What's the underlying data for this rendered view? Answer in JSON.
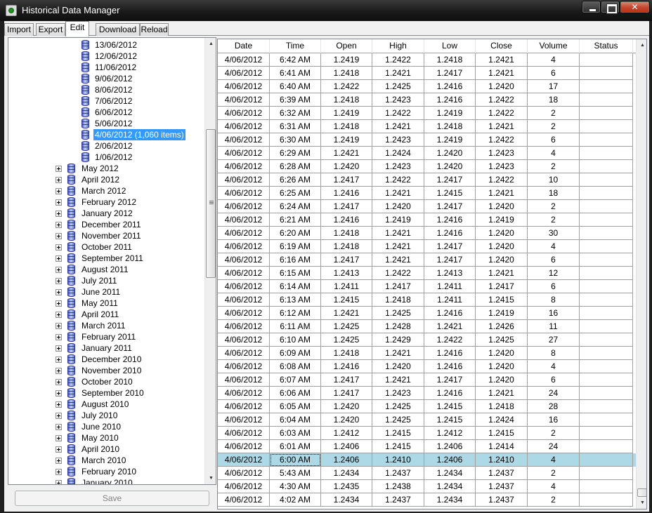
{
  "window": {
    "title": "Historical Data Manager"
  },
  "tabs": [
    "Import",
    "Export",
    "Edit",
    "Download",
    "Reload"
  ],
  "active_tab": "Edit",
  "tree": {
    "days": [
      "13/06/2012",
      "12/06/2012",
      "11/06/2012",
      "9/06/2012",
      "8/06/2012",
      "7/06/2012",
      "6/06/2012",
      "5/06/2012",
      "4/06/2012 (1,060 items)",
      "2/06/2012",
      "1/06/2012"
    ],
    "selected_day": "4/06/2012 (1,060 items)",
    "months": [
      "May 2012",
      "April 2012",
      "March 2012",
      "February 2012",
      "January 2012",
      "December 2011",
      "November 2011",
      "October 2011",
      "September 2011",
      "August 2011",
      "July 2011",
      "June 2011",
      "May 2011",
      "April 2011",
      "March 2011",
      "February 2011",
      "January 2011",
      "December 2010",
      "November 2010",
      "October 2010",
      "September 2010",
      "August 2010",
      "July 2010",
      "June 2010",
      "May 2010",
      "April 2010",
      "March 2010",
      "February 2010",
      "January 2010"
    ]
  },
  "save_label": "Save",
  "grid": {
    "columns": [
      "Date",
      "Time",
      "Open",
      "High",
      "Low",
      "Close",
      "Volume",
      "Status"
    ],
    "selected_time": "6:00 AM",
    "rows": [
      [
        "4/06/2012",
        "6:42 AM",
        "1.2419",
        "1.2422",
        "1.2418",
        "1.2421",
        "4",
        ""
      ],
      [
        "4/06/2012",
        "6:41 AM",
        "1.2418",
        "1.2421",
        "1.2417",
        "1.2421",
        "6",
        ""
      ],
      [
        "4/06/2012",
        "6:40 AM",
        "1.2422",
        "1.2425",
        "1.2416",
        "1.2420",
        "17",
        ""
      ],
      [
        "4/06/2012",
        "6:39 AM",
        "1.2418",
        "1.2423",
        "1.2416",
        "1.2422",
        "18",
        ""
      ],
      [
        "4/06/2012",
        "6:32 AM",
        "1.2419",
        "1.2422",
        "1.2419",
        "1.2422",
        "2",
        ""
      ],
      [
        "4/06/2012",
        "6:31 AM",
        "1.2418",
        "1.2421",
        "1.2418",
        "1.2421",
        "2",
        ""
      ],
      [
        "4/06/2012",
        "6:30 AM",
        "1.2419",
        "1.2423",
        "1.2419",
        "1.2422",
        "6",
        ""
      ],
      [
        "4/06/2012",
        "6:29 AM",
        "1.2421",
        "1.2424",
        "1.2420",
        "1.2423",
        "4",
        ""
      ],
      [
        "4/06/2012",
        "6:28 AM",
        "1.2420",
        "1.2423",
        "1.2420",
        "1.2423",
        "2",
        ""
      ],
      [
        "4/06/2012",
        "6:26 AM",
        "1.2417",
        "1.2422",
        "1.2417",
        "1.2422",
        "10",
        ""
      ],
      [
        "4/06/2012",
        "6:25 AM",
        "1.2416",
        "1.2421",
        "1.2415",
        "1.2421",
        "18",
        ""
      ],
      [
        "4/06/2012",
        "6:24 AM",
        "1.2417",
        "1.2420",
        "1.2417",
        "1.2420",
        "2",
        ""
      ],
      [
        "4/06/2012",
        "6:21 AM",
        "1.2416",
        "1.2419",
        "1.2416",
        "1.2419",
        "2",
        ""
      ],
      [
        "4/06/2012",
        "6:20 AM",
        "1.2418",
        "1.2421",
        "1.2416",
        "1.2420",
        "30",
        ""
      ],
      [
        "4/06/2012",
        "6:19 AM",
        "1.2418",
        "1.2421",
        "1.2417",
        "1.2420",
        "4",
        ""
      ],
      [
        "4/06/2012",
        "6:16 AM",
        "1.2417",
        "1.2421",
        "1.2417",
        "1.2420",
        "6",
        ""
      ],
      [
        "4/06/2012",
        "6:15 AM",
        "1.2413",
        "1.2422",
        "1.2413",
        "1.2421",
        "12",
        ""
      ],
      [
        "4/06/2012",
        "6:14 AM",
        "1.2411",
        "1.2417",
        "1.2411",
        "1.2417",
        "6",
        ""
      ],
      [
        "4/06/2012",
        "6:13 AM",
        "1.2415",
        "1.2418",
        "1.2411",
        "1.2415",
        "8",
        ""
      ],
      [
        "4/06/2012",
        "6:12 AM",
        "1.2421",
        "1.2425",
        "1.2416",
        "1.2419",
        "16",
        ""
      ],
      [
        "4/06/2012",
        "6:11 AM",
        "1.2425",
        "1.2428",
        "1.2421",
        "1.2426",
        "11",
        ""
      ],
      [
        "4/06/2012",
        "6:10 AM",
        "1.2425",
        "1.2429",
        "1.2422",
        "1.2425",
        "27",
        ""
      ],
      [
        "4/06/2012",
        "6:09 AM",
        "1.2418",
        "1.2421",
        "1.2416",
        "1.2420",
        "8",
        ""
      ],
      [
        "4/06/2012",
        "6:08 AM",
        "1.2416",
        "1.2420",
        "1.2416",
        "1.2420",
        "4",
        ""
      ],
      [
        "4/06/2012",
        "6:07 AM",
        "1.2417",
        "1.2421",
        "1.2417",
        "1.2420",
        "6",
        ""
      ],
      [
        "4/06/2012",
        "6:06 AM",
        "1.2417",
        "1.2423",
        "1.2416",
        "1.2421",
        "24",
        ""
      ],
      [
        "4/06/2012",
        "6:05 AM",
        "1.2420",
        "1.2425",
        "1.2415",
        "1.2418",
        "28",
        ""
      ],
      [
        "4/06/2012",
        "6:04 AM",
        "1.2420",
        "1.2425",
        "1.2415",
        "1.2424",
        "16",
        ""
      ],
      [
        "4/06/2012",
        "6:03 AM",
        "1.2412",
        "1.2415",
        "1.2412",
        "1.2415",
        "2",
        ""
      ],
      [
        "4/06/2012",
        "6:01 AM",
        "1.2406",
        "1.2415",
        "1.2406",
        "1.2414",
        "24",
        ""
      ],
      [
        "4/06/2012",
        "6:00 AM",
        "1.2406",
        "1.2410",
        "1.2406",
        "1.2410",
        "4",
        ""
      ],
      [
        "4/06/2012",
        "5:43 AM",
        "1.2434",
        "1.2437",
        "1.2434",
        "1.2437",
        "2",
        ""
      ],
      [
        "4/06/2012",
        "4:30 AM",
        "1.2435",
        "1.2438",
        "1.2434",
        "1.2437",
        "4",
        ""
      ],
      [
        "4/06/2012",
        "4:02 AM",
        "1.2434",
        "1.2437",
        "1.2434",
        "1.2437",
        "2",
        ""
      ]
    ]
  },
  "colors": {
    "selection": "#3399ff",
    "row_highlight": "#add8e6",
    "close_button": "#c64a31"
  },
  "icons": {
    "app": "app-chart-icon",
    "tree_item": "database-icon",
    "expander": "plus-expander-icon"
  }
}
